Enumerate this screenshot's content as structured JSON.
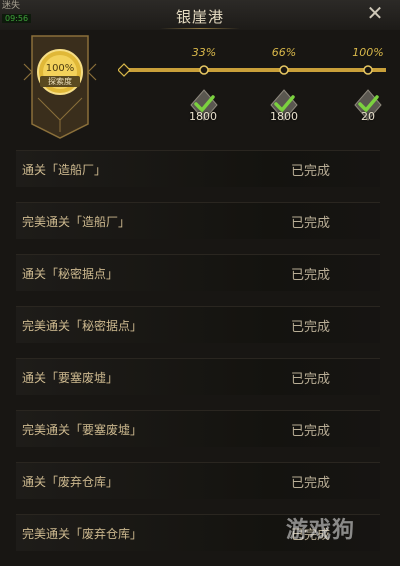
{
  "header": {
    "corner_text": "迷失",
    "corner_timer": "09:56",
    "title": "银崖港",
    "close_icon": "close-icon"
  },
  "medal": {
    "percent_label": "100%",
    "label": "探索度",
    "progress": 1.0
  },
  "milestones": [
    {
      "pct_label": "33%",
      "reward": "1800",
      "claimed": true
    },
    {
      "pct_label": "66%",
      "reward": "1800",
      "claimed": true
    },
    {
      "pct_label": "100%",
      "reward": "20",
      "claimed": true
    }
  ],
  "tasks": [
    {
      "label": "通关「造船厂」",
      "status": "已完成"
    },
    {
      "label": "完美通关「造船厂」",
      "status": "已完成"
    },
    {
      "label": "通关「秘密据点」",
      "status": "已完成"
    },
    {
      "label": "完美通关「秘密据点」",
      "status": "已完成"
    },
    {
      "label": "通关「要塞废墟」",
      "status": "已完成"
    },
    {
      "label": "完美通关「要塞废墟」",
      "status": "已完成"
    },
    {
      "label": "通关「废弃仓库」",
      "status": "已完成"
    },
    {
      "label": "完美通关「废弃仓库」",
      "status": "已完成"
    }
  ],
  "watermark": "游戏狗",
  "colors": {
    "gold": "#d9b84a",
    "check": "#6fbf3a",
    "background": "#181613"
  }
}
